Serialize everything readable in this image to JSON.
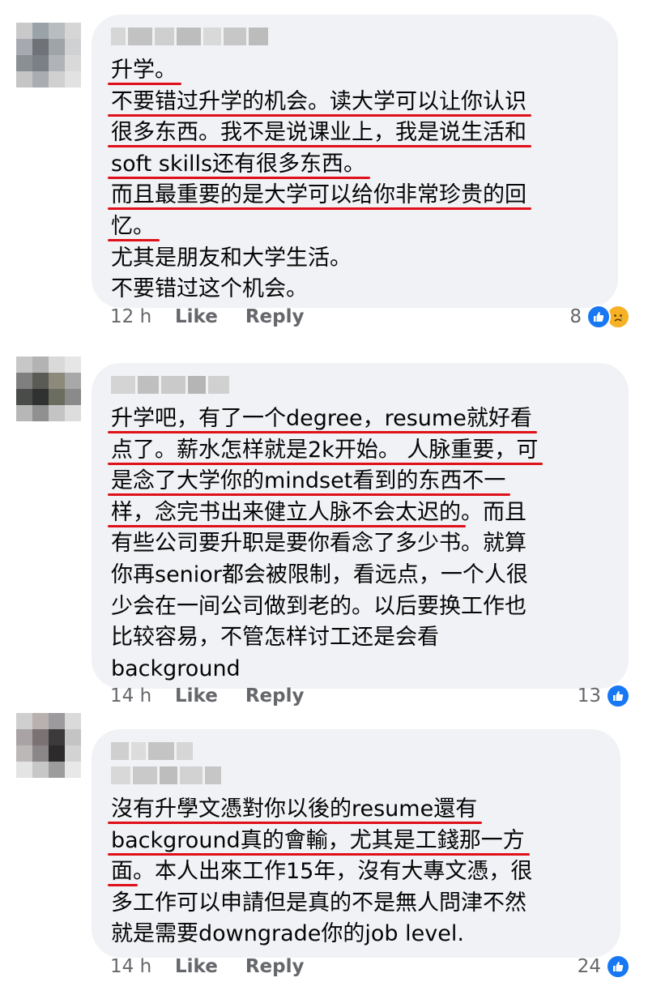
{
  "comments": [
    {
      "lines": [
        {
          "text": "升学。",
          "underlined": true
        },
        {
          "text": "不要错过升学的机会。读大学可以让你认识",
          "underlined": true
        },
        {
          "text": "很多东西。我不是说课业上，我是说生活和",
          "underlined": true
        },
        {
          "text": "soft skills还有很多东西。",
          "underlined": true
        },
        {
          "text": "而且最重要的是大学可以给你非常珍贵的回",
          "underlined": true
        },
        {
          "text": "忆。",
          "underlined": true
        },
        {
          "text": "尤其是朋友和大学生活。",
          "underlined": false
        },
        {
          "text": "不要错过这个机会。",
          "underlined": false
        }
      ],
      "time": "12 h",
      "like_label": "Like",
      "reply_label": "Reply",
      "reaction_count": "8",
      "reactions": [
        "like-icon",
        "sad-icon"
      ]
    },
    {
      "lines": [
        {
          "text": "升学吧，有了一个degree，resume就好看",
          "underlined": true
        },
        {
          "text": "点了。薪水怎样就是2k开始。 人脉重要，可",
          "underlined": true
        },
        {
          "text": "是念了大学你的mindset看到的东西不一",
          "underlined": true
        },
        {
          "text": "样，念完书出来健立人脉不会太迟的",
          "underlined": true,
          "tail": "。而且"
        },
        {
          "text": "有些公司要升职是要你看念了多少书。就算",
          "underlined": false
        },
        {
          "text": "你再senior都会被限制，看远点，一个人很",
          "underlined": false
        },
        {
          "text": "少会在一间公司做到老的。以后要换工作也",
          "underlined": false
        },
        {
          "text": "比较容易，不管怎样讨工还是会看",
          "underlined": false
        },
        {
          "text": "background",
          "underlined": false
        }
      ],
      "time": "14 h",
      "like_label": "Like",
      "reply_label": "Reply",
      "reaction_count": "13",
      "reactions": [
        "like-icon"
      ]
    },
    {
      "lines": [
        {
          "text": "沒有升學文憑對你以後的resume還有",
          "underlined": true
        },
        {
          "text": "background真的會輸，尤其是工錢那一方",
          "underlined": true
        },
        {
          "text": "面",
          "underlined": true,
          "tail": "。本人出來工作15年，沒有大專文憑，很"
        },
        {
          "text": "多工作可以申請但是真的不是無人問津不然",
          "underlined": false
        },
        {
          "text": "就是需要downgrade你的job level.",
          "underlined": false
        }
      ],
      "time": "14 h",
      "like_label": "Like",
      "reply_label": "Reply",
      "reaction_count": "24",
      "reactions": [
        "like-icon"
      ]
    }
  ],
  "colors": {
    "bubble": "#f0f2f5",
    "underline": "#e0101a",
    "like": "#1877f2",
    "sad": "#f7b125",
    "meta": "#65676b"
  }
}
